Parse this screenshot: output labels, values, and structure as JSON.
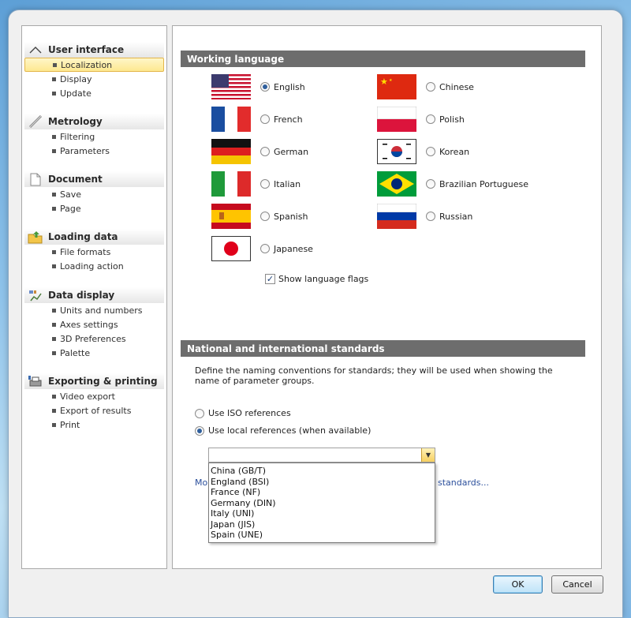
{
  "sidebar": {
    "groups": [
      {
        "title": "User interface",
        "icon": "chevron-up-icon",
        "items": [
          "Localization",
          "Display",
          "Update"
        ]
      },
      {
        "title": "Metrology",
        "icon": "ruler-pencil-icon",
        "items": [
          "Filtering",
          "Parameters"
        ]
      },
      {
        "title": "Document",
        "icon": "document-icon",
        "items": [
          "Save",
          "Page"
        ]
      },
      {
        "title": "Loading data",
        "icon": "folder-load-icon",
        "items": [
          "File formats",
          "Loading action"
        ]
      },
      {
        "title": "Data display",
        "icon": "chart-display-icon",
        "items": [
          "Units and numbers",
          "Axes settings",
          "3D Preferences",
          "Palette"
        ]
      },
      {
        "title": "Exporting & printing",
        "icon": "printer-export-icon",
        "items": [
          "Video export",
          "Export of results",
          "Print"
        ]
      }
    ],
    "selected": "Localization"
  },
  "working_language": {
    "title": "Working language",
    "languages": [
      {
        "label": "English",
        "flag": "usa-flag-icon",
        "checked": true
      },
      {
        "label": "Chinese",
        "flag": "china-flag-icon",
        "checked": false
      },
      {
        "label": "French",
        "flag": "france-flag-icon",
        "checked": false
      },
      {
        "label": "Polish",
        "flag": "poland-flag-icon",
        "checked": false
      },
      {
        "label": "German",
        "flag": "germany-flag-icon",
        "checked": false
      },
      {
        "label": "Korean",
        "flag": "korea-flag-icon",
        "checked": false
      },
      {
        "label": "Italian",
        "flag": "italy-flag-icon",
        "checked": false
      },
      {
        "label": "Brazilian Portuguese",
        "flag": "brazil-flag-icon",
        "checked": false
      },
      {
        "label": "Spanish",
        "flag": "spain-flag-icon",
        "checked": false
      },
      {
        "label": "Russian",
        "flag": "russia-flag-icon",
        "checked": false
      },
      {
        "label": "Japanese",
        "flag": "japan-flag-icon",
        "checked": false
      }
    ],
    "show_flags_label": "Show language flags",
    "show_flags_checked": true
  },
  "standards": {
    "title": "National and international standards",
    "description": "Define the naming conventions for standards; they will be used when showing the name of parameter groups.",
    "options": [
      {
        "label": "Use ISO references",
        "checked": false
      },
      {
        "label": "Use local references (when available)",
        "checked": true
      }
    ],
    "combo_value": "",
    "dropdown_options": [
      "China (GB/T)",
      "England (BSI)",
      "France (NF)",
      "Germany (DIN)",
      "Italy (UNI)",
      "Japan (JIS)",
      "Spain (UNE)"
    ],
    "more_link_prefix": "Mo",
    "more_link_suffix": "standards..."
  },
  "buttons": {
    "ok": "OK",
    "cancel": "Cancel"
  },
  "colors": {
    "section_bar": "#6d6d6d",
    "selection": "#fde890",
    "default_button": "#bfe3f8"
  }
}
